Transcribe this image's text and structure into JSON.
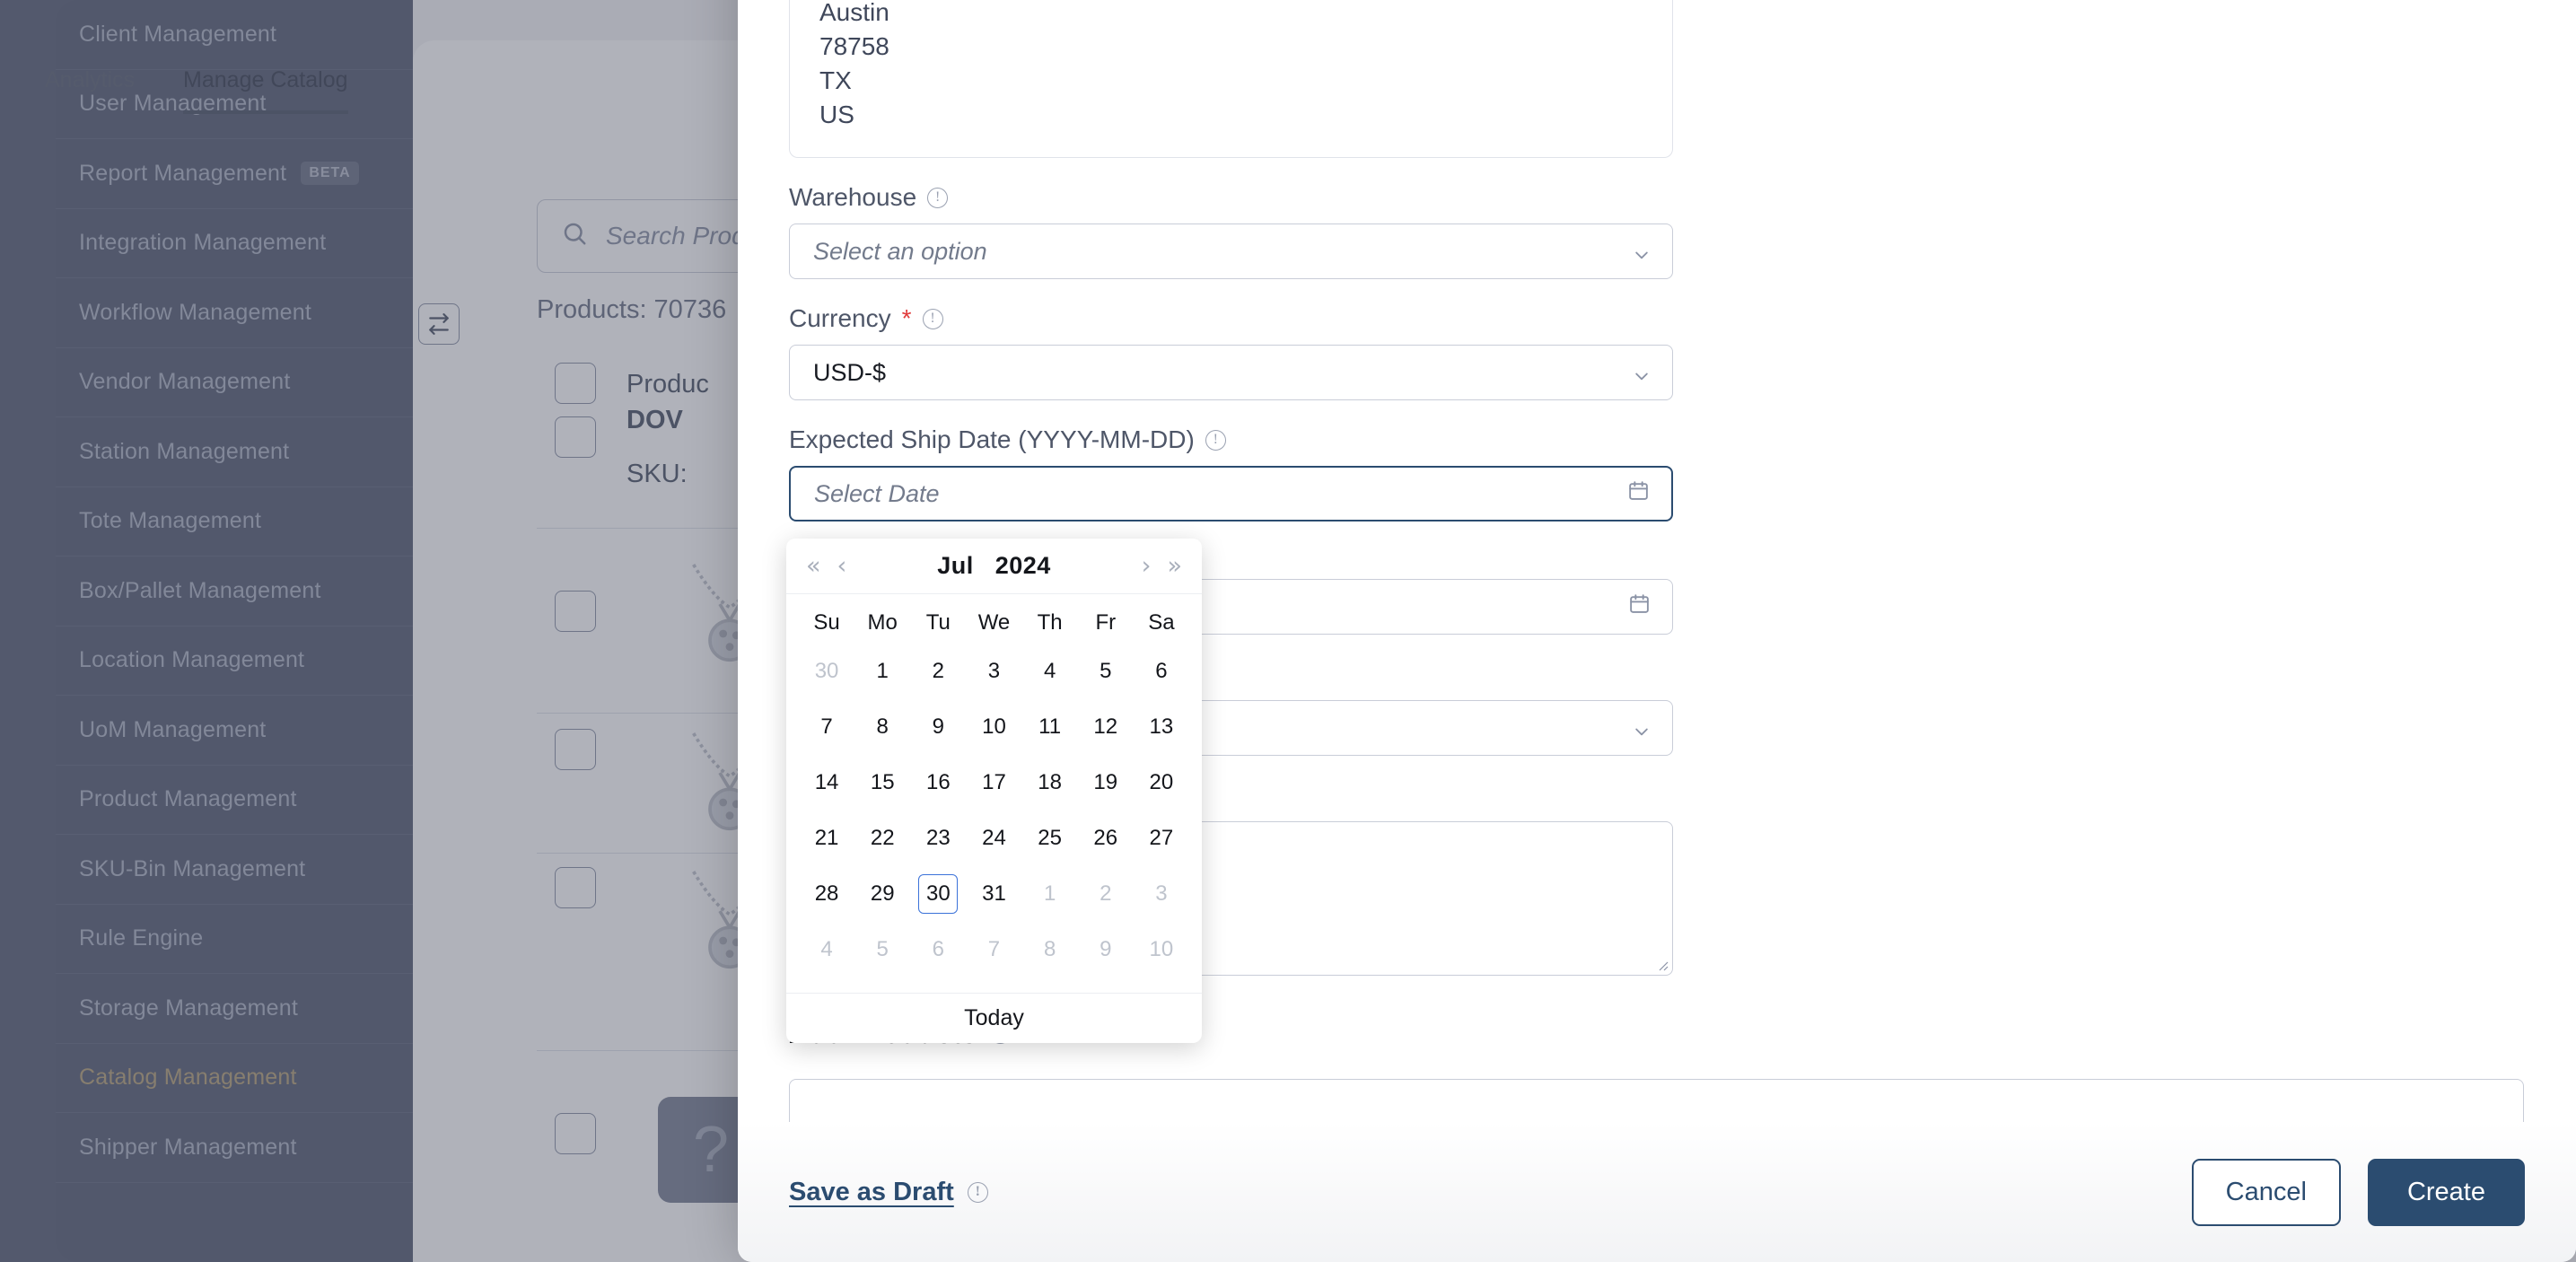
{
  "sidebar": {
    "items": [
      {
        "label": "Client Management",
        "active": false,
        "badge": ""
      },
      {
        "label": "User Management",
        "active": false,
        "badge": ""
      },
      {
        "label": "Report Management",
        "active": false,
        "badge": "BETA"
      },
      {
        "label": "Integration Management",
        "active": false,
        "badge": ""
      },
      {
        "label": "Workflow Management",
        "active": false,
        "badge": ""
      },
      {
        "label": "Vendor Management",
        "active": false,
        "badge": ""
      },
      {
        "label": "Station Management",
        "active": false,
        "badge": ""
      },
      {
        "label": "Tote Management",
        "active": false,
        "badge": ""
      },
      {
        "label": "Box/Pallet Management",
        "active": false,
        "badge": ""
      },
      {
        "label": "Location Management",
        "active": false,
        "badge": ""
      },
      {
        "label": "UoM Management",
        "active": false,
        "badge": ""
      },
      {
        "label": "Product Management",
        "active": false,
        "badge": ""
      },
      {
        "label": "SKU-Bin Management",
        "active": false,
        "badge": ""
      },
      {
        "label": "Rule Engine",
        "active": false,
        "badge": ""
      },
      {
        "label": "Storage Management",
        "active": false,
        "badge": ""
      },
      {
        "label": "Catalog Management",
        "active": true,
        "badge": ""
      },
      {
        "label": "Shipper Management",
        "active": false,
        "badge": ""
      }
    ],
    "active_color": "#b7a379",
    "background_color": "#585f74"
  },
  "background_page": {
    "tabs": [
      {
        "label": "Analytics",
        "active": false
      },
      {
        "label": "Manage Catalog",
        "active": true
      }
    ],
    "swap_icon": "swap-arrows-icon",
    "search_placeholder": "Search Prod",
    "search_icon": "search-icon",
    "products_count_label": "Products: 70736",
    "column_header": "Produc",
    "row_title": "DOV",
    "row_sku_label": "SKU:",
    "help_button_label": "?"
  },
  "modal": {
    "address": {
      "lines": [
        "Austin",
        "78758",
        "TX",
        "US"
      ]
    },
    "fields": [
      {
        "key": "warehouse",
        "label": "Warehouse",
        "required": false,
        "has_info": true,
        "type": "select",
        "value": "",
        "placeholder": "Select an option",
        "focused": false
      },
      {
        "key": "currency",
        "label": "Currency",
        "required": true,
        "has_info": true,
        "type": "select",
        "value": "USD-$",
        "placeholder": "",
        "focused": false
      },
      {
        "key": "expected_ship_date",
        "label": "Expected Ship Date (YYYY-MM-DD)",
        "required": false,
        "has_info": true,
        "type": "date",
        "value": "",
        "placeholder": "Select Date",
        "focused": true
      }
    ],
    "hidden_fields": [
      {
        "key": "second_date",
        "type": "date",
        "value": "",
        "placeholder": ""
      },
      {
        "key": "hidden_select",
        "type": "select",
        "value": "",
        "placeholder": ""
      },
      {
        "key": "notes",
        "type": "textarea",
        "value": "",
        "placeholder": ""
      }
    ],
    "add_products": {
      "title": "Add Products",
      "has_info": true,
      "input_value": "",
      "input_placeholder": ""
    },
    "footer": {
      "save_as_draft_label": "Save as Draft",
      "save_as_draft_has_info": true,
      "cancel_label": "Cancel",
      "create_label": "Create",
      "primary_color": "#2b4c70"
    }
  },
  "datepicker": {
    "prev_year_icon": "«",
    "prev_month_icon": "‹",
    "next_month_icon": "›",
    "next_year_icon": "»",
    "month_label": "Jul",
    "year_label": "2024",
    "day_headers": [
      "Su",
      "Mo",
      "Tu",
      "We",
      "Th",
      "Fr",
      "Sa"
    ],
    "weeks": [
      [
        {
          "d": "30",
          "muted": true,
          "today": false
        },
        {
          "d": "1",
          "muted": false,
          "today": false
        },
        {
          "d": "2",
          "muted": false,
          "today": false
        },
        {
          "d": "3",
          "muted": false,
          "today": false
        },
        {
          "d": "4",
          "muted": false,
          "today": false
        },
        {
          "d": "5",
          "muted": false,
          "today": false
        },
        {
          "d": "6",
          "muted": false,
          "today": false
        }
      ],
      [
        {
          "d": "7",
          "muted": false,
          "today": false
        },
        {
          "d": "8",
          "muted": false,
          "today": false
        },
        {
          "d": "9",
          "muted": false,
          "today": false
        },
        {
          "d": "10",
          "muted": false,
          "today": false
        },
        {
          "d": "11",
          "muted": false,
          "today": false
        },
        {
          "d": "12",
          "muted": false,
          "today": false
        },
        {
          "d": "13",
          "muted": false,
          "today": false
        }
      ],
      [
        {
          "d": "14",
          "muted": false,
          "today": false
        },
        {
          "d": "15",
          "muted": false,
          "today": false
        },
        {
          "d": "16",
          "muted": false,
          "today": false
        },
        {
          "d": "17",
          "muted": false,
          "today": false
        },
        {
          "d": "18",
          "muted": false,
          "today": false
        },
        {
          "d": "19",
          "muted": false,
          "today": false
        },
        {
          "d": "20",
          "muted": false,
          "today": false
        }
      ],
      [
        {
          "d": "21",
          "muted": false,
          "today": false
        },
        {
          "d": "22",
          "muted": false,
          "today": false
        },
        {
          "d": "23",
          "muted": false,
          "today": false
        },
        {
          "d": "24",
          "muted": false,
          "today": false
        },
        {
          "d": "25",
          "muted": false,
          "today": false
        },
        {
          "d": "26",
          "muted": false,
          "today": false
        },
        {
          "d": "27",
          "muted": false,
          "today": false
        }
      ],
      [
        {
          "d": "28",
          "muted": false,
          "today": false
        },
        {
          "d": "29",
          "muted": false,
          "today": false
        },
        {
          "d": "30",
          "muted": false,
          "today": true
        },
        {
          "d": "31",
          "muted": false,
          "today": false
        },
        {
          "d": "1",
          "muted": true,
          "today": false
        },
        {
          "d": "2",
          "muted": true,
          "today": false
        },
        {
          "d": "3",
          "muted": true,
          "today": false
        }
      ],
      [
        {
          "d": "4",
          "muted": true,
          "today": false
        },
        {
          "d": "5",
          "muted": true,
          "today": false
        },
        {
          "d": "6",
          "muted": true,
          "today": false
        },
        {
          "d": "7",
          "muted": true,
          "today": false
        },
        {
          "d": "8",
          "muted": true,
          "today": false
        },
        {
          "d": "9",
          "muted": true,
          "today": false
        },
        {
          "d": "10",
          "muted": true,
          "today": false
        }
      ]
    ],
    "today_label": "Today",
    "today_highlight_color": "#3b72d9"
  }
}
